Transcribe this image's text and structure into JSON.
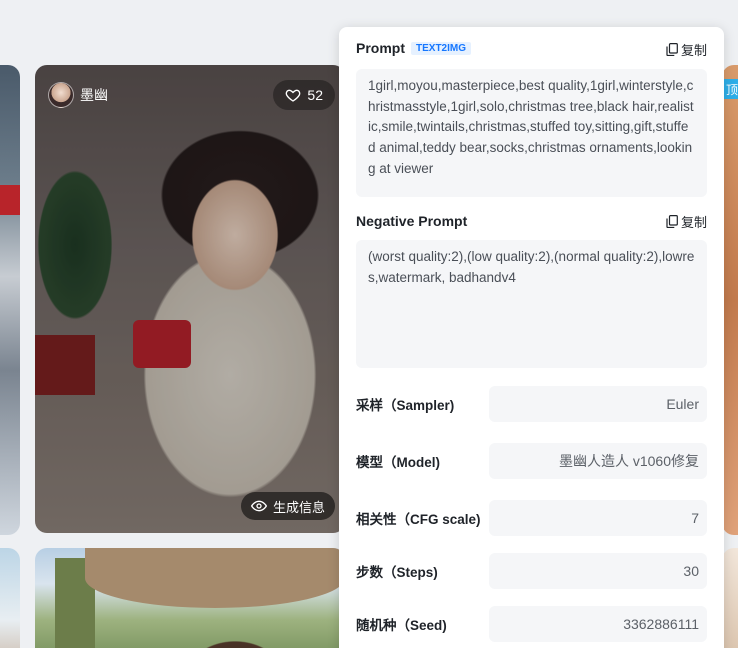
{
  "gallery": {
    "main_card": {
      "author_name": "墨幽",
      "likes": "52",
      "gen_info_label": "生成信息"
    },
    "right_card_badge": "顶"
  },
  "panel": {
    "prompt": {
      "title": "Prompt",
      "tag": "TEXT2IMG",
      "copy_label": "复制",
      "text": "1girl,moyou,masterpiece,best quality,1girl,winterstyle,christmasstyle,1girl,solo,christmas tree,black hair,realistic,smile,twintails,christmas,stuffed toy,sitting,gift,stuffed animal,teddy bear,socks,christmas ornaments,looking at viewer"
    },
    "negative_prompt": {
      "title": "Negative Prompt",
      "copy_label": "复制",
      "text": "(worst quality:2),(low quality:2),(normal quality:2),lowres,watermark, badhandv4"
    },
    "params": [
      {
        "label": "采样（Sampler)",
        "value": "Euler"
      },
      {
        "label": "模型（Model)",
        "value": "墨幽人造人 v1060修复"
      },
      {
        "label": "相关性（CFG scale)",
        "value": "7"
      },
      {
        "label": "步数（Steps)",
        "value": "30"
      },
      {
        "label": "随机种（Seed)",
        "value": "3362886111"
      }
    ]
  },
  "colors": {
    "accent": "#1677ff",
    "panel_bg": "#ffffff",
    "field_bg": "#f5f6f8"
  }
}
